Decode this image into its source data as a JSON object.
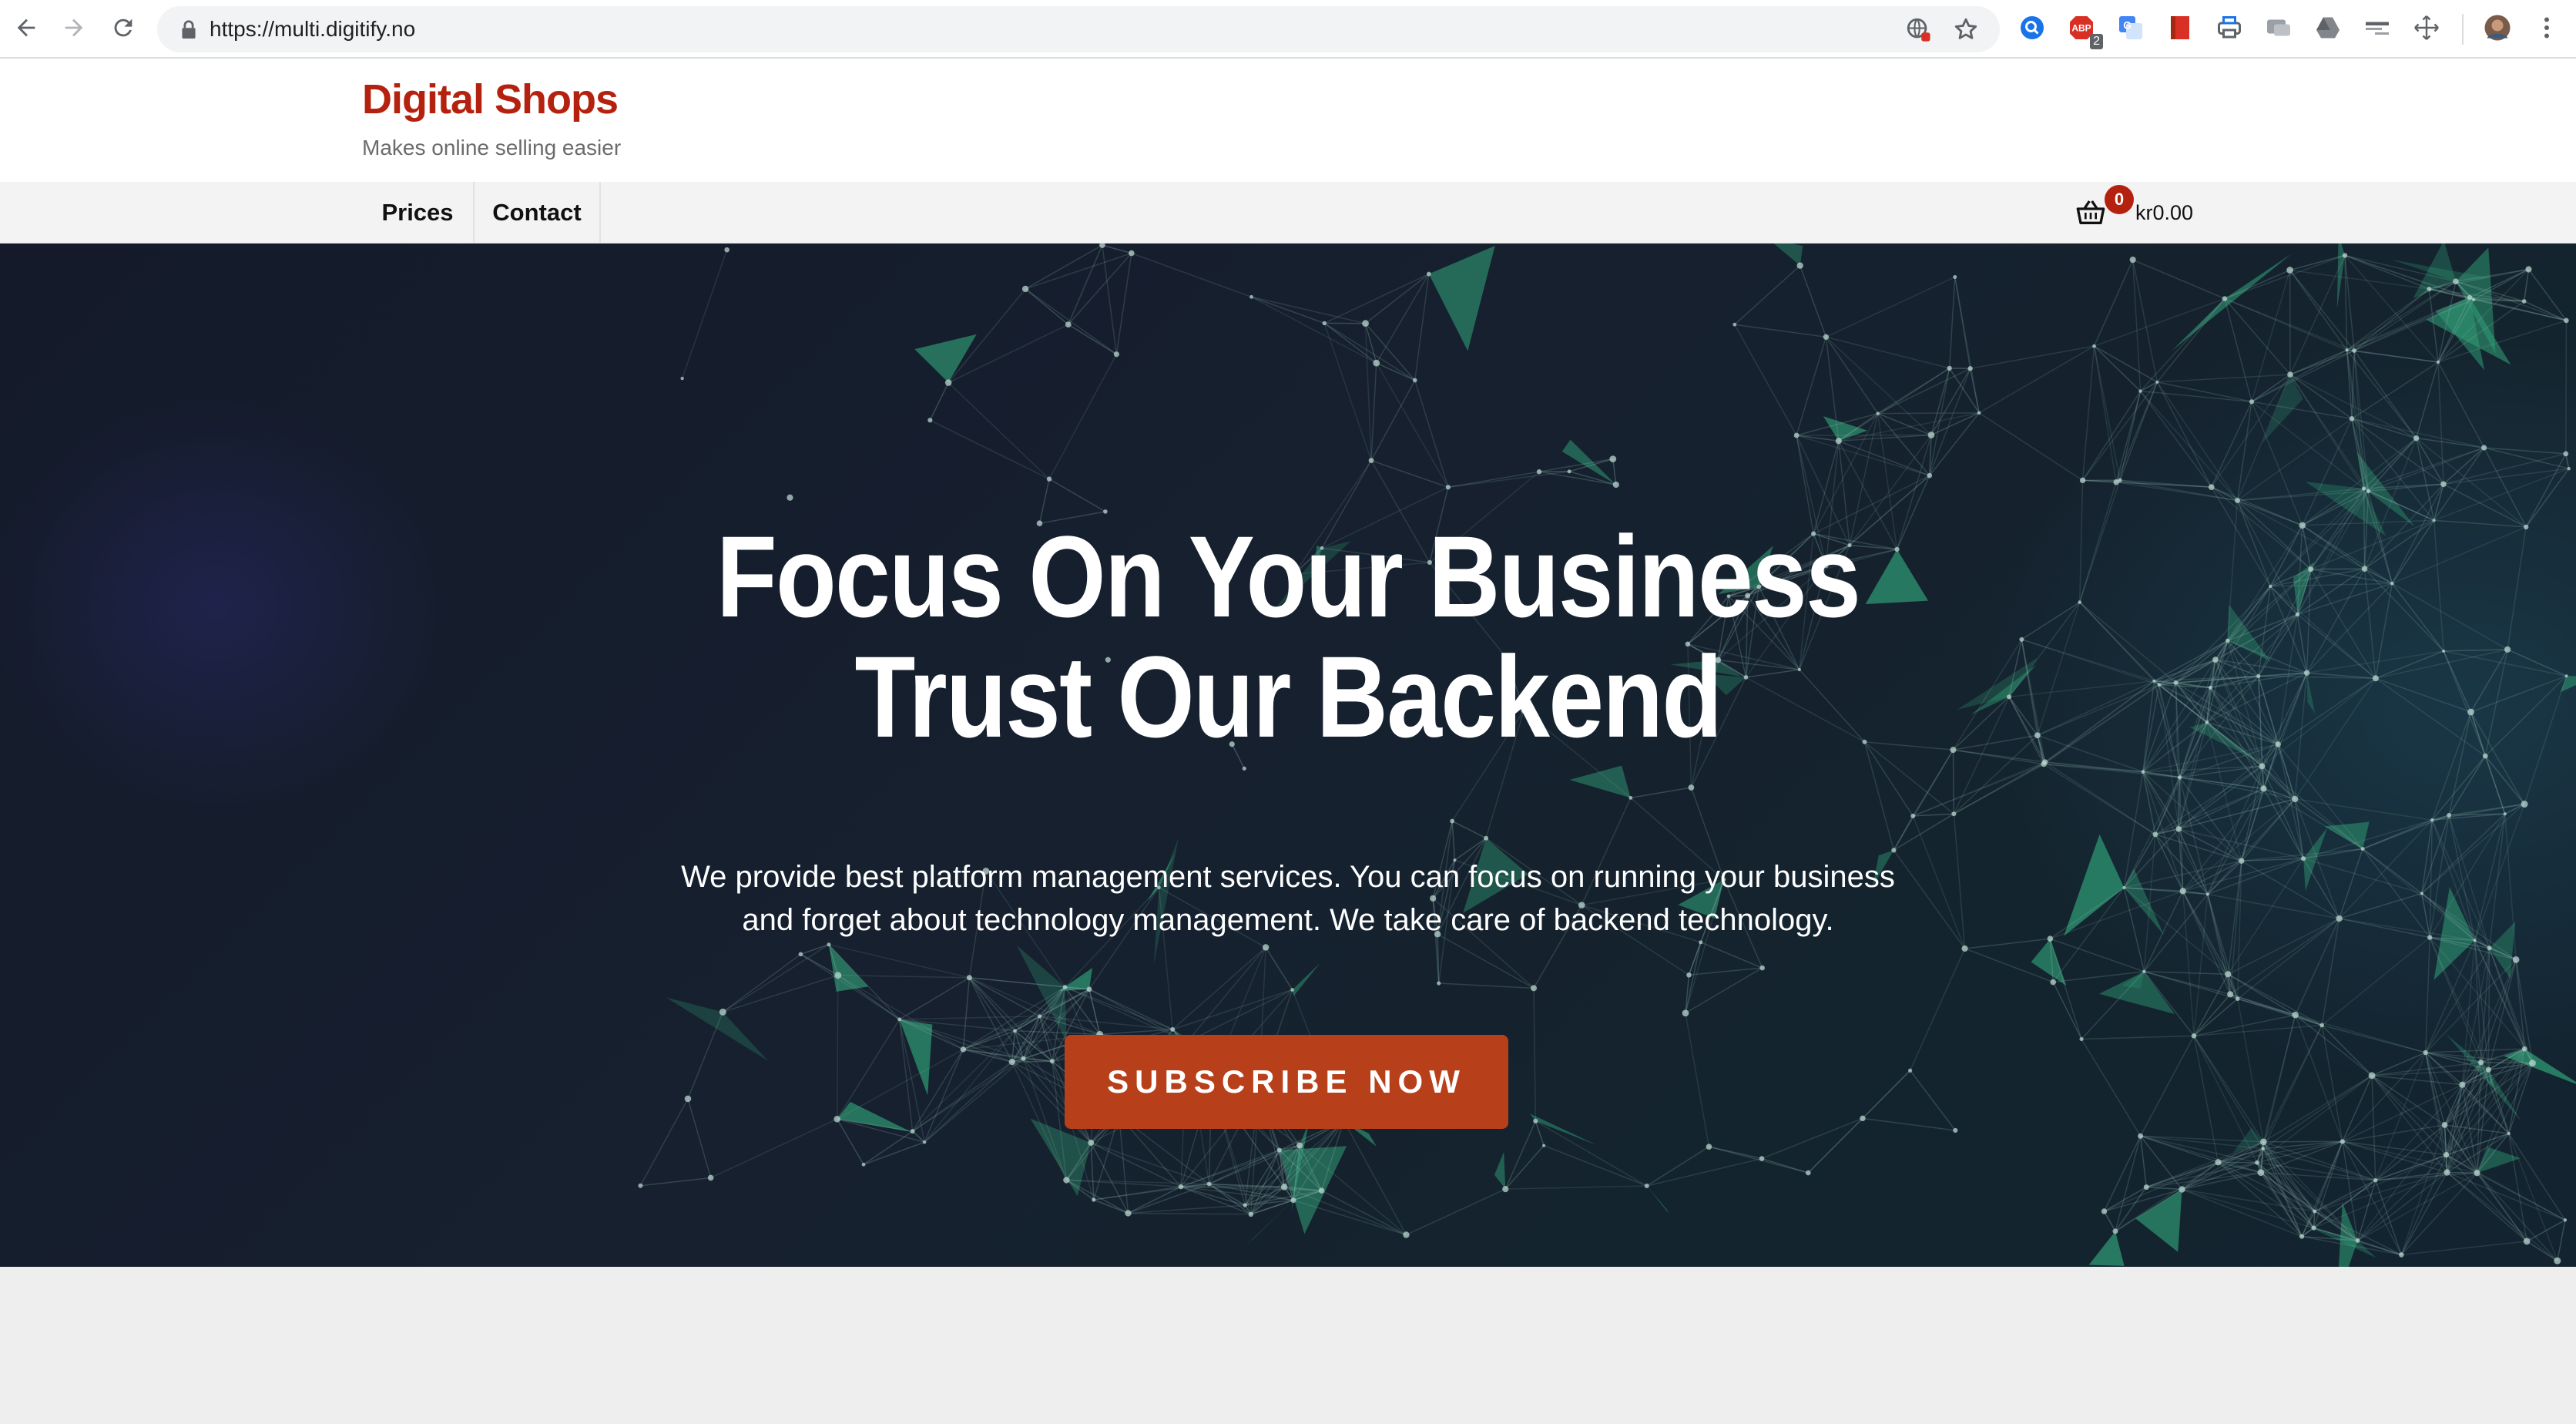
{
  "browser": {
    "url": "https://multi.digitify.no",
    "extensions": [
      {
        "name": "quick-search-extension-icon"
      },
      {
        "name": "adblock-extension-icon",
        "badge": "2"
      },
      {
        "name": "google-translate-extension-icon"
      },
      {
        "name": "red-bookmark-extension-icon"
      },
      {
        "name": "print-extension-icon"
      },
      {
        "name": "screen-capture-extension-icon"
      },
      {
        "name": "drive-extension-icon"
      },
      {
        "name": "dictionary-extension-icon"
      },
      {
        "name": "move-extension-icon"
      }
    ]
  },
  "site": {
    "title": "Digital Shops",
    "tagline": "Makes online selling easier",
    "brand_color": "#b5210f"
  },
  "nav": {
    "items": [
      {
        "label": "Prices"
      },
      {
        "label": "Contact"
      }
    ]
  },
  "cart": {
    "count": "0",
    "total": "kr0.00"
  },
  "hero": {
    "headline_line1": "Focus On Your Business",
    "headline_line2": "Trust Our Backend",
    "sub_line1": "We provide best platform management services. You can focus on running your business",
    "sub_line2": "and forget about technology management. We take care of backend technology.",
    "cta_label": "SUBSCRIBE NOW",
    "cta_color": "#b7401a",
    "accent_color": "#2f9a74"
  }
}
